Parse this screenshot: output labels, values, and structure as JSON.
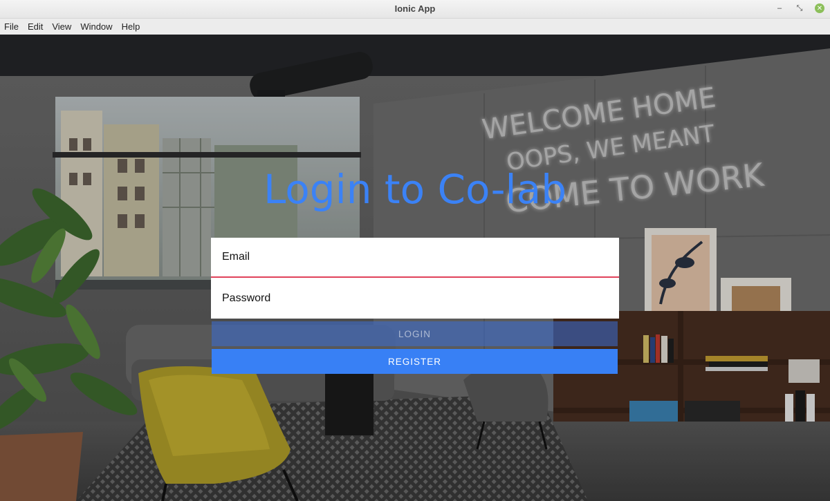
{
  "window": {
    "title": "Ionic App",
    "controls": {
      "minimize": "–",
      "restore": "⤡",
      "close": "✕"
    }
  },
  "menu": {
    "items": [
      "File",
      "Edit",
      "View",
      "Window",
      "Help"
    ]
  },
  "background": {
    "neon_lines": [
      "WELCOME HOME",
      "OOPS, WE MEANT",
      "COME TO WORK"
    ]
  },
  "login": {
    "heading": "Login to Co-lab",
    "email_placeholder": "Email",
    "password_placeholder": "Password",
    "login_label": "LOGIN",
    "register_label": "REGISTER"
  },
  "colors": {
    "accent": "#3880f5",
    "heading": "#3b82f6",
    "email_underline": "#e0415a"
  }
}
